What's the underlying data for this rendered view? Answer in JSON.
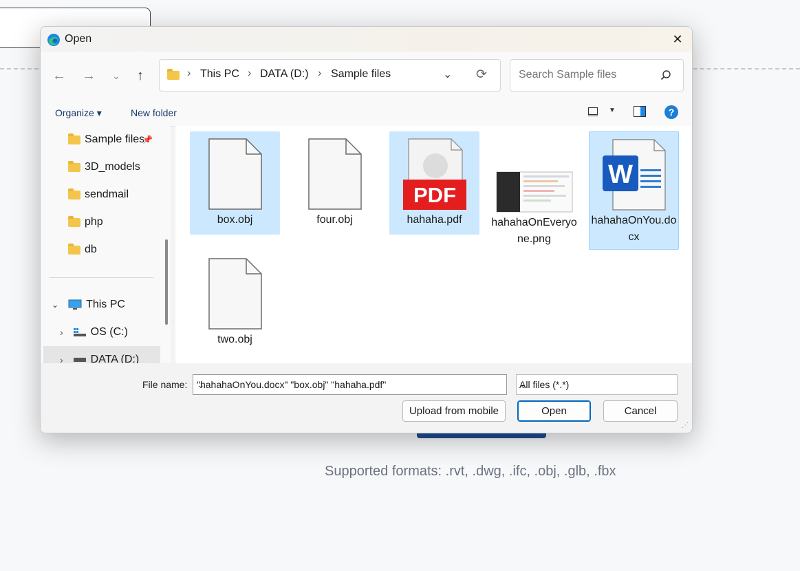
{
  "dialog": {
    "title": "Open",
    "address": {
      "part1": "This PC",
      "part2": "DATA (D:)",
      "part3": "Sample files"
    },
    "search_placeholder": "Search Sample files",
    "toolbar": {
      "organize": "Organize ▾",
      "new_folder": "New folder"
    },
    "sidebar": {
      "folders": [
        "Sample files",
        "3D_models",
        "sendmail",
        "php",
        "db"
      ],
      "this_pc": "This PC",
      "drives": [
        "OS (C:)",
        "DATA (D:)"
      ]
    },
    "files": [
      {
        "name": "box.obj",
        "selected": true
      },
      {
        "name": "four.obj",
        "selected": false
      },
      {
        "name": "hahaha.pdf",
        "selected": true,
        "badge": "PDF"
      },
      {
        "name": "hahahaOnEveryone.png",
        "selected": false
      },
      {
        "name": "hahahaOnYou.docx",
        "selected": true,
        "badge": "W"
      },
      {
        "name": "two.obj",
        "selected": false
      }
    ],
    "file_name_label": "File name:",
    "file_name_value": "\"hahahaOnYou.docx\" \"box.obj\" \"hahaha.pdf\"",
    "file_type_value": "All files (*.*)",
    "buttons": {
      "upload": "Upload from mobile",
      "open": "Open",
      "cancel": "Cancel"
    }
  },
  "page": {
    "formats_text": "Supported formats: .rvt, .dwg, .ifc, .obj, .glb, .fbx"
  },
  "colors": {
    "selection": "#cce8ff",
    "accent": "#0067c0",
    "page_button": "#1d4e8f"
  }
}
